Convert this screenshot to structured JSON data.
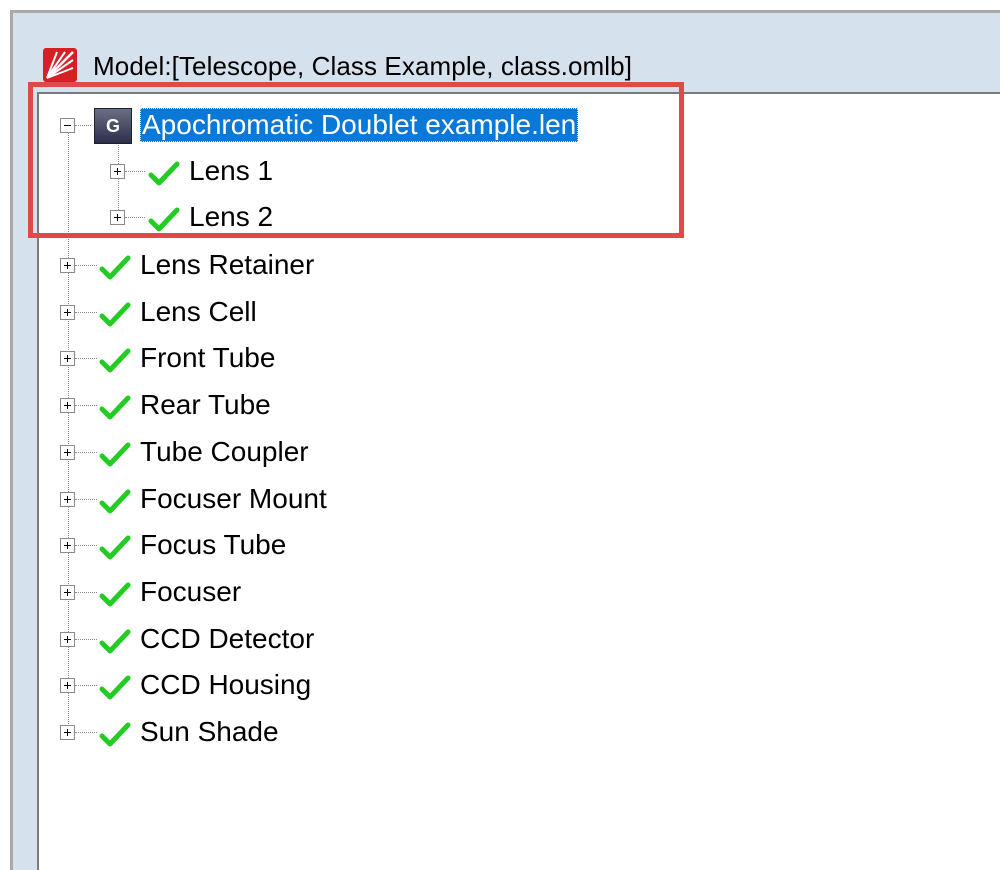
{
  "window": {
    "title": "Model:[Telescope, Class Example, class.omlb]",
    "app_icon": "app-logo-icon"
  },
  "tree": {
    "root": {
      "label": "Apochromatic Doublet example.len",
      "badge": "G",
      "expanded": true,
      "selected": true
    },
    "root_children": [
      {
        "label": "Lens 1"
      },
      {
        "label": "Lens 2"
      }
    ],
    "items": [
      {
        "label": "Lens Retainer"
      },
      {
        "label": "Lens Cell"
      },
      {
        "label": "Front Tube"
      },
      {
        "label": "Rear Tube"
      },
      {
        "label": "Tube Coupler"
      },
      {
        "label": "Focuser Mount"
      },
      {
        "label": "Focus Tube"
      },
      {
        "label": "Focuser"
      },
      {
        "label": "CCD Detector"
      },
      {
        "label": "CCD Housing"
      },
      {
        "label": "Sun Shade"
      }
    ]
  },
  "colors": {
    "highlight_box": "#e0494b",
    "selection": "#0a78d7",
    "check": "#22cc22",
    "frame": "#d6e1ee"
  }
}
